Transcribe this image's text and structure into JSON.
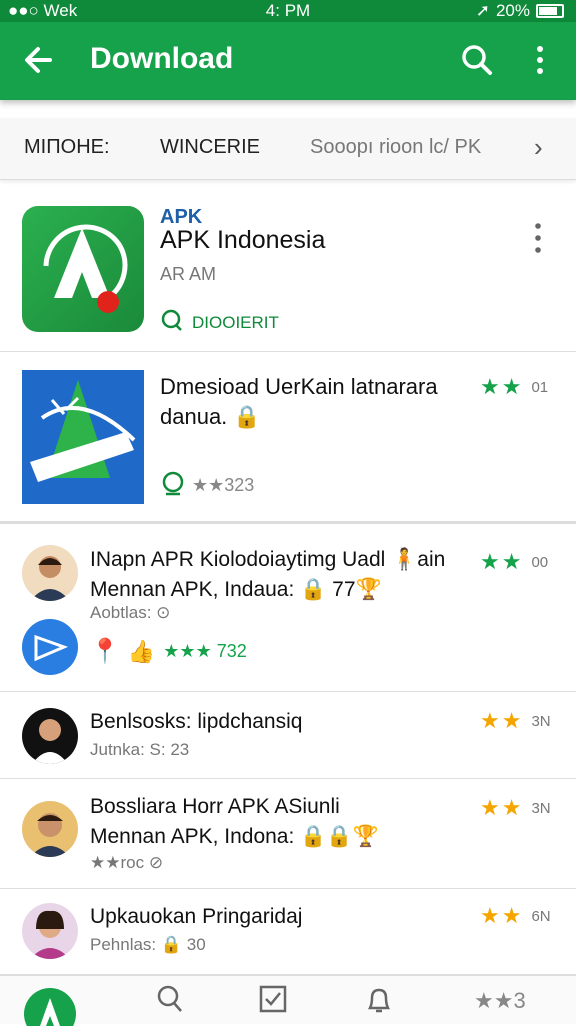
{
  "status": {
    "left": "●●○ Wek",
    "time": "4: PM",
    "battery": "20%"
  },
  "appbar": {
    "title": "Download"
  },
  "tabs": [
    {
      "label": "MIΠOHE:"
    },
    {
      "label": "WINCERIE"
    },
    {
      "label": "Sooopı rioon lc/ PK"
    }
  ],
  "featured": {
    "small_label": "APK",
    "name": "APK Indonesia",
    "sub": "AR AM",
    "badge": "DIOOIERIT"
  },
  "app2": {
    "name": "Dmesioad UerKain latnarara danua.",
    "emoji": "🔒",
    "rating_text": "01",
    "stats": "★★323"
  },
  "posts": [
    {
      "title": "INapn APR Kiolodoiaytimg Uadl 🧍ain",
      "title2": "Mennan APK,  Indaua: 🔒 77🏆",
      "meta": "Aobtlas: ⊙",
      "stats": "★★★ 732",
      "rating_text": "00"
    },
    {
      "title": "Benlsosks: lipdchansiq",
      "meta": "Jutnka: S: 23",
      "rating_text": "3N"
    },
    {
      "title": "Bossliara Horr APK ASiunli",
      "title2": "Mennan APK,  Indona: 🔒🔒🏆",
      "meta": "★★roc ⊘",
      "rating_text": "3N"
    },
    {
      "title": "Upkauokan Pringaridaj",
      "meta": "Pehnlas: 🔒 30",
      "rating_text": "6N"
    }
  ],
  "bottomnav": {
    "last_label": "★★3"
  },
  "colors": {
    "brand": "#15a24a",
    "status": "#0e8a3a",
    "star_green": "#15a24a",
    "star_yellow": "#f5a500"
  }
}
